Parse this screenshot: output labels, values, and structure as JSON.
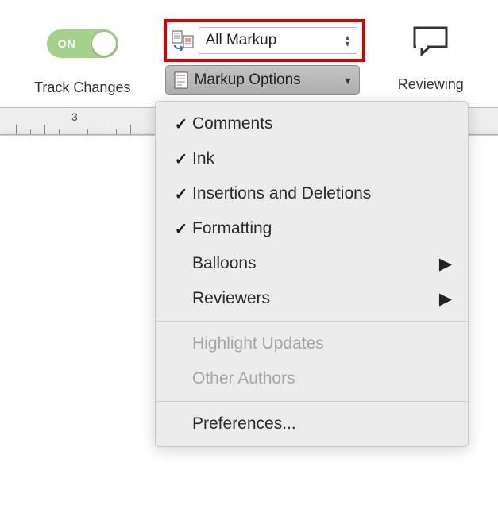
{
  "toolbar": {
    "track_changes": {
      "label": "Track Changes",
      "toggle_text": "ON"
    },
    "markup_display": {
      "selected": "All Markup"
    },
    "markup_options_label": "Markup Options",
    "reviewing_label": "Reviewing"
  },
  "ruler": {
    "number": "3"
  },
  "menu": {
    "items": [
      {
        "label": "Comments",
        "checked": true,
        "submenu": false,
        "enabled": true
      },
      {
        "label": "Ink",
        "checked": true,
        "submenu": false,
        "enabled": true
      },
      {
        "label": "Insertions and Deletions",
        "checked": true,
        "submenu": false,
        "enabled": true
      },
      {
        "label": "Formatting",
        "checked": true,
        "submenu": false,
        "enabled": true
      },
      {
        "label": "Balloons",
        "checked": false,
        "submenu": true,
        "enabled": true
      },
      {
        "label": "Reviewers",
        "checked": false,
        "submenu": true,
        "enabled": true
      }
    ],
    "secondary": [
      {
        "label": "Highlight Updates",
        "enabled": false
      },
      {
        "label": "Other Authors",
        "enabled": false
      }
    ],
    "tertiary": [
      {
        "label": "Preferences...",
        "enabled": true
      }
    ]
  }
}
